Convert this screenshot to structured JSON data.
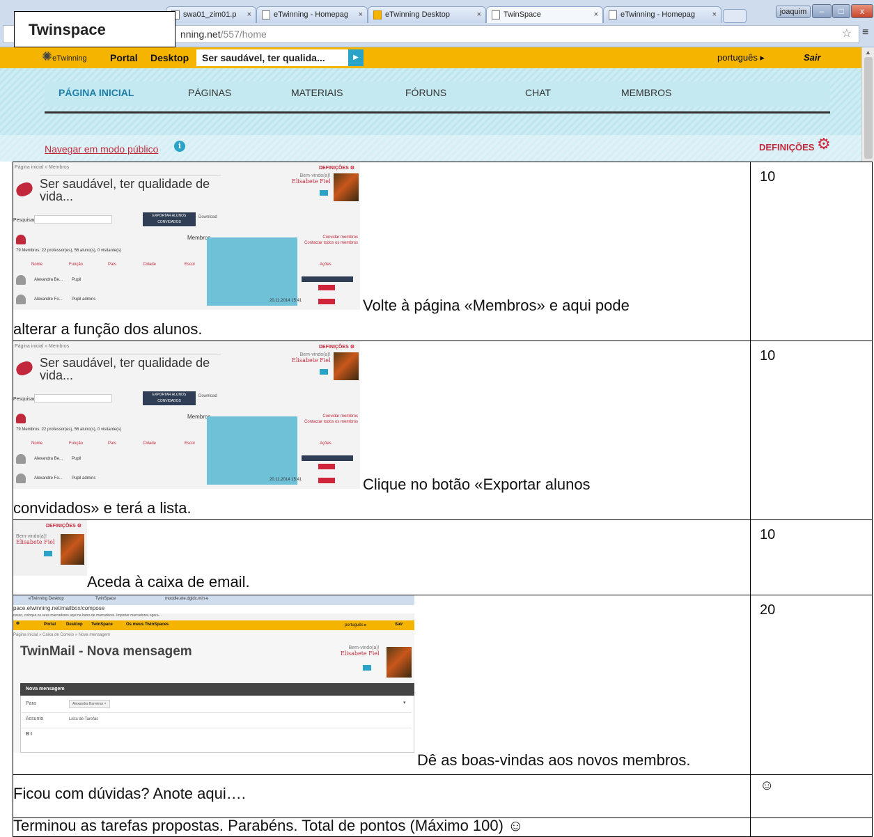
{
  "document_title": "Twinspace",
  "browser": {
    "tabs": [
      {
        "label": "swa01_zim01.p"
      },
      {
        "label": "eTwinning - Homepag"
      },
      {
        "label": "eTwinning Desktop"
      },
      {
        "label": "TwinSpace"
      },
      {
        "label": "eTwinning - Homepag"
      }
    ],
    "tab_close_glyph": "×",
    "user": "joaquim",
    "url_prefix": "nning.net",
    "url_path": "/557/home"
  },
  "etwinning": {
    "logo_text": "eTwinning",
    "top_links": [
      "Portal",
      "Desktop"
    ],
    "space_name": "Ser saudável, ter qualida...",
    "language": "português ▸",
    "logout": "Sair",
    "nav": [
      "PÁGINA INICIAL",
      "PÁGINAS",
      "MATERIAIS",
      "FÓRUNS",
      "CHAT",
      "MEMBROS"
    ],
    "public_link": "Navegar em modo público",
    "settings": "DEFINIÇÕES",
    "colors": {
      "topbar": "#f4b400",
      "nav_active": "#1d7fa8",
      "accent_red": "#c2283b",
      "info_blue": "#2aa3c9"
    }
  },
  "members_thumbnail": {
    "breadcrumb": "Página inicial  »  Membros",
    "settings": "DEFINIÇÕES",
    "title_line1": "Ser saudável, ter qualidade de",
    "title_line2": "vida...",
    "welcome": "Bem-vindo(a)!",
    "user_name": "Elisabete Fiel",
    "search_label": "Pesquisar",
    "export_button": "EXPORTAR ALUNOS CONVIDADOS",
    "download": "Download",
    "members_label": "Membros",
    "invite": "Convidar membros",
    "contact_all": "Contactar todos os membros",
    "counts": "79 Membros: 22 professor(es), 56 aluno(s), 0 visitante(s)",
    "col_nome": "Nome",
    "col_funcao": "Função",
    "col_pais": "País",
    "col_cidade": "Cidade",
    "col_escola": "Escol",
    "col_acoes": "Ações",
    "member1": "Alexandra Be...",
    "member1_role": "Pupil",
    "member2": "Alexandre Fo...",
    "member2_role": "Pupil admins",
    "member2_date": "20.11.2014 15:41",
    "reset_btn": "Reinicializar a palavra-passe",
    "delete_btn": "Apagar"
  },
  "twinmail_thumbnail": {
    "tab1": "eTwinning Desktop",
    "tab2": "TwinSpace",
    "tab3": "moodle.ete.dgidc.min-e",
    "url": "pace.etwinning.net/mailbox/compose",
    "bookmarks": "cesso, coloque os seus marcadores aqui na barra de marcadores. Importar marcadores agora...",
    "links": [
      "Portal",
      "Desktop",
      "TwinSpace",
      "Os meus TwinSpaces"
    ],
    "language": "português ▸",
    "logout": "Sair",
    "breadcrumb": "Página inicial  »  Caixa de Correio  »  Nova mensagem",
    "title": "TwinMail - Nova mensagem",
    "welcome": "Bem-vindo(a)!",
    "user_name": "Elisabete Fiel",
    "panel_title": "Nova mensagem",
    "to_label": "Para",
    "to_value": "Alexandra Barreiras ×",
    "subject_label": "Assunto",
    "subject_value": "Lista de Tarefas",
    "format": "B  I"
  },
  "tasks": [
    {
      "desc_line1": "Volte à página «Membros» e aqui pode",
      "desc_line2": "alterar a função dos alunos.",
      "points": "10"
    },
    {
      "desc_line1": "Clique no botão «Exportar alunos",
      "desc_line2": "convidados» e terá a lista.",
      "points": "10"
    },
    {
      "desc_line1": "Aceda à caixa de email.",
      "points": "10"
    },
    {
      "desc_line1": "Dê as boas-vindas aos novos membros.",
      "points": "20"
    },
    {
      "desc_line1": "Ficou com dúvidas? Anote aqui….",
      "points": "☺"
    },
    {
      "desc_line1": "Terminou as tarefas propostas. Parabéns. Total de pontos (Máximo 100) ☺",
      "points": ""
    }
  ]
}
